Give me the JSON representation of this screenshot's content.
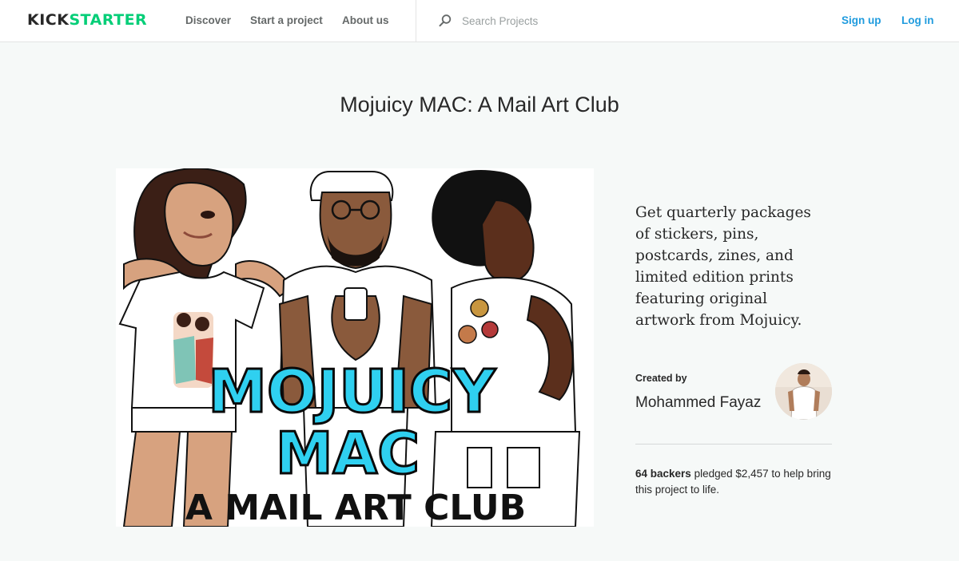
{
  "header": {
    "logo_left": "KICK",
    "logo_right": "STARTER",
    "nav": {
      "discover": "Discover",
      "start": "Start a project",
      "about": "About us"
    },
    "search": {
      "placeholder": "Search Projects",
      "value": ""
    },
    "signup": "Sign up",
    "login": "Log in"
  },
  "project": {
    "title": "Mojuicy MAC: A Mail Art Club",
    "image_text": {
      "line1": "MOJUICY",
      "line2": "MAC",
      "line3": "A MAIL ART CLUB"
    },
    "blurb": "Get quarterly packages of stickers, pins, postcards, zines, and limited edition prints featuring original artwork from Mojuicy.",
    "created_by_label": "Created by",
    "creator": "Mohammed Fayaz",
    "stats": {
      "backers": "64 backers",
      "text": " pledged $2,457 to help bring this project to life."
    }
  },
  "colors": {
    "brand_green": "#05ce78",
    "link_blue": "#1f9bde",
    "page_bg": "#f6f9f8",
    "text": "#282828"
  },
  "icons": [
    "search-icon"
  ]
}
